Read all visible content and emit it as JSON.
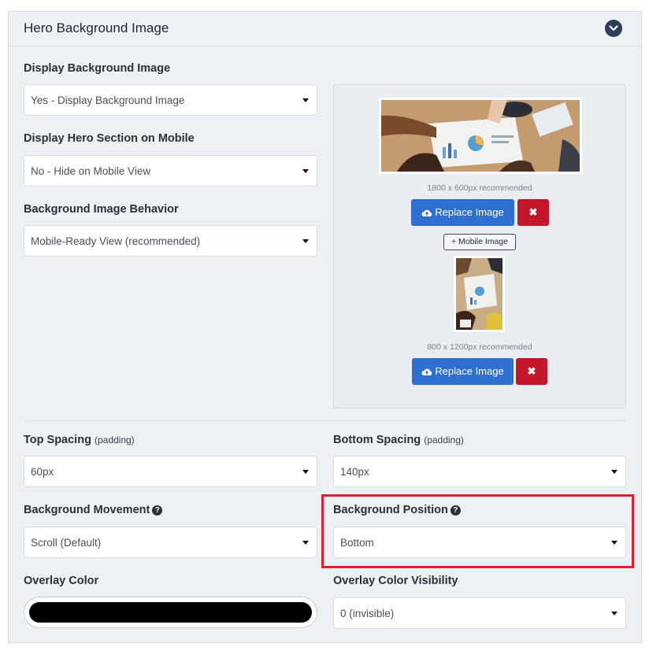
{
  "panel": {
    "title": "Hero Background Image"
  },
  "fields": {
    "display_bg": {
      "label": "Display Background Image",
      "value": "Yes - Display Background Image"
    },
    "display_mobile": {
      "label": "Display Hero Section on Mobile",
      "value": "No - Hide on Mobile View"
    },
    "bg_behavior": {
      "label": "Background Image Behavior",
      "value": "Mobile-Ready View (recommended)"
    },
    "top_spacing": {
      "label": "Top Spacing",
      "sub": "(padding)",
      "value": "60px"
    },
    "bottom_spacing": {
      "label": "Bottom Spacing",
      "sub": "(padding)",
      "value": "140px"
    },
    "bg_movement": {
      "label": "Background Movement",
      "value": "Scroll (Default)"
    },
    "bg_position": {
      "label": "Background Position",
      "value": "Bottom"
    },
    "overlay_color": {
      "label": "Overlay Color",
      "color": "#000000"
    },
    "overlay_visibility": {
      "label": "Overlay Color Visibility",
      "value": "0 (invisible)"
    }
  },
  "images": {
    "desktop": {
      "hint": "1800 x 600px recommended",
      "replace_label": "Replace Image",
      "remove_label": "✖"
    },
    "add_mobile_label": "+ Mobile Image",
    "mobile": {
      "hint": "800 x 1200px recommended",
      "replace_label": "Replace Image",
      "remove_label": "✖"
    }
  },
  "icons": {
    "collapse": "chevron-down-circle-icon",
    "help": "question-circle-icon",
    "upload": "cloud-upload-icon",
    "remove": "x-icon",
    "caret": "caret-down-icon"
  },
  "colors": {
    "accent_blue": "#2e6fd0",
    "danger_red": "#c4172c",
    "highlight": "#e0212d",
    "header_button": "#2c3e5c"
  }
}
